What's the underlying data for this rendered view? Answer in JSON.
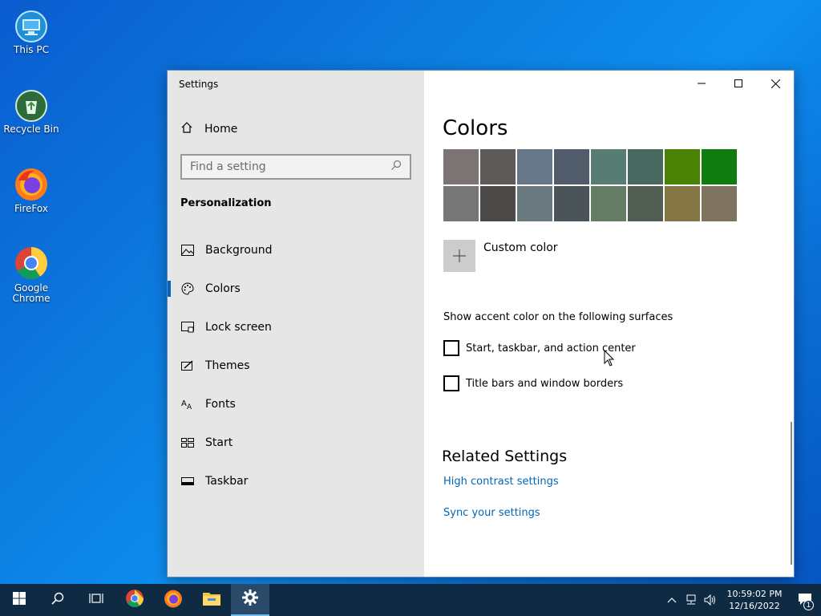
{
  "desktop": {
    "icons": [
      {
        "label": "This PC"
      },
      {
        "label": "Recycle Bin"
      },
      {
        "label": "FireFox"
      },
      {
        "label": "Google Chrome"
      }
    ]
  },
  "window": {
    "app_title": "Settings",
    "sidebar": {
      "home_label": "Home",
      "search_placeholder": "Find a setting",
      "section_header": "Personalization",
      "items": [
        {
          "label": "Background",
          "icon": "picture-icon"
        },
        {
          "label": "Colors",
          "icon": "palette-icon",
          "active": true
        },
        {
          "label": "Lock screen",
          "icon": "lock-screen-icon"
        },
        {
          "label": "Themes",
          "icon": "themes-icon"
        },
        {
          "label": "Fonts",
          "icon": "fonts-icon"
        },
        {
          "label": "Start",
          "icon": "start-icon"
        },
        {
          "label": "Taskbar",
          "icon": "taskbar-icon"
        }
      ]
    },
    "content": {
      "title": "Colors",
      "swatches": [
        "#7a7574",
        "#5d5a58",
        "#68768a",
        "#515c6b",
        "#567c73",
        "#486860",
        "#498205",
        "#107c10",
        "#767676",
        "#4c4a48",
        "#69797e",
        "#4a5459",
        "#647c64",
        "#525e54",
        "#847545",
        "#7e735f"
      ],
      "custom_color_label": "Custom color",
      "accent_header": "Show accent color on the following surfaces",
      "checkboxes": [
        {
          "label": "Start, taskbar, and action center",
          "checked": false
        },
        {
          "label": "Title bars and window borders",
          "checked": false
        }
      ],
      "related_title": "Related Settings",
      "links": [
        "High contrast settings",
        "Sync your settings"
      ]
    }
  },
  "taskbar": {
    "time": "10:59:02 PM",
    "date": "12/16/2022",
    "notification_count": "1"
  }
}
